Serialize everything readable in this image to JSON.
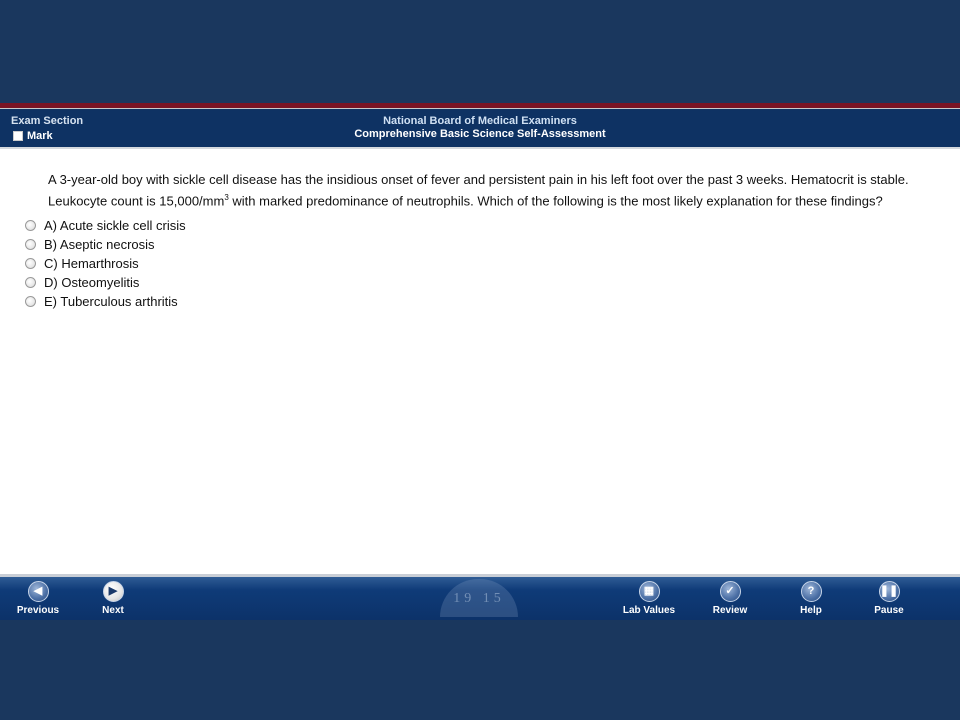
{
  "header": {
    "exam_section": "Exam Section",
    "mark_label": "Mark",
    "title_line1": "National Board of Medical Examiners",
    "title_line2": "Comprehensive Basic Science Self-Assessment"
  },
  "question": {
    "text_part1": "A 3-year-old boy with sickle cell disease has the insidious onset of fever and persistent pain in his left foot over the past 3 weeks. Hematocrit is stable. Leukocyte count is 15,000/mm",
    "superscript": "3",
    "text_part2": " with marked predominance of neutrophils. Which of the following is the most likely explanation for these findings?"
  },
  "answers": [
    {
      "label": "A) Acute sickle cell crisis"
    },
    {
      "label": "B) Aseptic necrosis"
    },
    {
      "label": "C) Hemarthrosis"
    },
    {
      "label": "D) Osteomyelitis"
    },
    {
      "label": "E) Tuberculous arthritis"
    }
  ],
  "footer": {
    "previous": "Previous",
    "next": "Next",
    "lab_values": "Lab Values",
    "review": "Review",
    "help": "Help",
    "pause": "Pause",
    "seal_text": "19 15"
  },
  "icons": {
    "previous": "left-arrow-icon",
    "next": "right-arrow-icon",
    "lab_values": "lab-values-icon",
    "review": "checkmark-icon",
    "help": "question-mark-icon",
    "pause": "pause-icon"
  },
  "colors": {
    "background": "#1a375e",
    "header": "#0e3263",
    "accent_red": "#7a1424",
    "footer": "#0c3269"
  }
}
